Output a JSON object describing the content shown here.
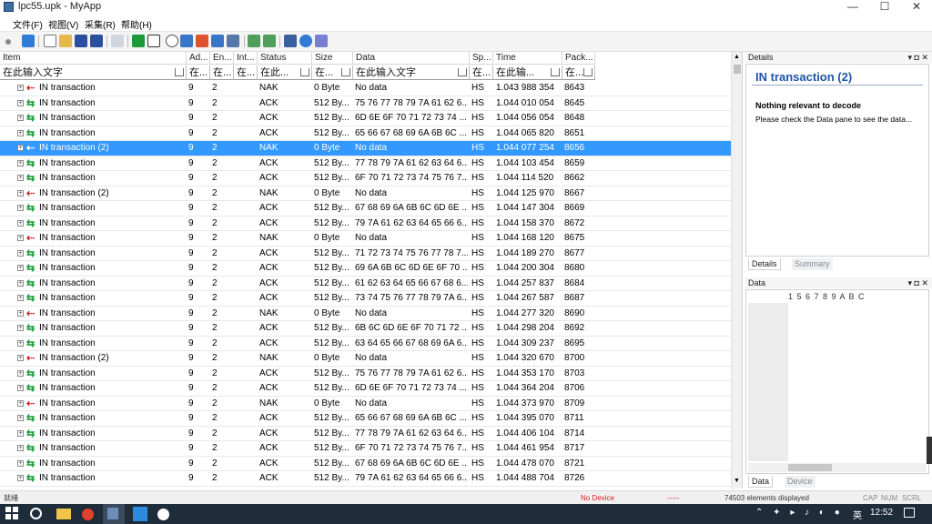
{
  "window": {
    "title": "lpc55.upk - MyApp",
    "minimize": "—",
    "maximize": "☐",
    "close": "✕"
  },
  "menu": [
    "文件(F)",
    "视图(V)",
    "采集(R)",
    "帮助(H)"
  ],
  "columns": [
    "Item",
    "Ad...",
    "En...",
    "Int...",
    "Status",
    "Size",
    "Data",
    "Sp...",
    "Time",
    "Pack..."
  ],
  "filters": [
    "在此输入文字",
    "在...",
    "在...",
    "在...",
    "在此...",
    "在...",
    "在此输入文字",
    "在...",
    "在此输...",
    "在..."
  ],
  "rows": [
    {
      "arrow": "red",
      "item": "IN transaction",
      "ad": "9",
      "en": "2",
      "status": "NAK",
      "size": "0 Byte",
      "data": "No data",
      "sp": "HS",
      "time": "1.043 988 354",
      "pack": "8643",
      "sel": false
    },
    {
      "arrow": "green",
      "item": "IN transaction",
      "ad": "9",
      "en": "2",
      "status": "ACK",
      "size": "512 By...",
      "data": "75 76 77 78 79 7A 61 62 6...",
      "sp": "HS",
      "time": "1.044 010 054",
      "pack": "8645",
      "sel": false
    },
    {
      "arrow": "green",
      "item": "IN transaction",
      "ad": "9",
      "en": "2",
      "status": "ACK",
      "size": "512 By...",
      "data": "6D 6E 6F 70 71 72 73 74 ...",
      "sp": "HS",
      "time": "1.044 056 054",
      "pack": "8648",
      "sel": false
    },
    {
      "arrow": "green",
      "item": "IN transaction",
      "ad": "9",
      "en": "2",
      "status": "ACK",
      "size": "512 By...",
      "data": "65 66 67 68 69 6A 6B 6C ...",
      "sp": "HS",
      "time": "1.044 065 820",
      "pack": "8651",
      "sel": false
    },
    {
      "arrow": "red",
      "item": "IN transaction (2)",
      "ad": "9",
      "en": "2",
      "status": "NAK",
      "size": "0 Byte",
      "data": "No data",
      "sp": "HS",
      "time": "1.044 077 254",
      "pack": "8656",
      "sel": true
    },
    {
      "arrow": "green",
      "item": "IN transaction",
      "ad": "9",
      "en": "2",
      "status": "ACK",
      "size": "512 By...",
      "data": "77 78 79 7A 61 62 63 64 6...",
      "sp": "HS",
      "time": "1.044 103 454",
      "pack": "8659",
      "sel": false
    },
    {
      "arrow": "green",
      "item": "IN transaction",
      "ad": "9",
      "en": "2",
      "status": "ACK",
      "size": "512 By...",
      "data": "6F 70 71 72 73 74 75 76 7...",
      "sp": "HS",
      "time": "1.044 114 520",
      "pack": "8662",
      "sel": false
    },
    {
      "arrow": "red",
      "item": "IN transaction (2)",
      "ad": "9",
      "en": "2",
      "status": "NAK",
      "size": "0 Byte",
      "data": "No data",
      "sp": "HS",
      "time": "1.044 125 970",
      "pack": "8667",
      "sel": false
    },
    {
      "arrow": "green",
      "item": "IN transaction",
      "ad": "9",
      "en": "2",
      "status": "ACK",
      "size": "512 By...",
      "data": "67 68 69 6A 6B 6C 6D 6E ...",
      "sp": "HS",
      "time": "1.044 147 304",
      "pack": "8669",
      "sel": false
    },
    {
      "arrow": "green",
      "item": "IN transaction",
      "ad": "9",
      "en": "2",
      "status": "ACK",
      "size": "512 By...",
      "data": "79 7A 61 62 63 64 65 66 6...",
      "sp": "HS",
      "time": "1.044 158 370",
      "pack": "8672",
      "sel": false
    },
    {
      "arrow": "red",
      "item": "IN transaction",
      "ad": "9",
      "en": "2",
      "status": "NAK",
      "size": "0 Byte",
      "data": "No data",
      "sp": "HS",
      "time": "1.044 168 120",
      "pack": "8675",
      "sel": false
    },
    {
      "arrow": "green",
      "item": "IN transaction",
      "ad": "9",
      "en": "2",
      "status": "ACK",
      "size": "512 By...",
      "data": "71 72 73 74 75 76 77 78 7...",
      "sp": "HS",
      "time": "1.044 189 270",
      "pack": "8677",
      "sel": false
    },
    {
      "arrow": "green",
      "item": "IN transaction",
      "ad": "9",
      "en": "2",
      "status": "ACK",
      "size": "512 By...",
      "data": "69 6A 6B 6C 6D 6E 6F 70 ...",
      "sp": "HS",
      "time": "1.044 200 304",
      "pack": "8680",
      "sel": false
    },
    {
      "arrow": "green",
      "item": "IN transaction",
      "ad": "9",
      "en": "2",
      "status": "ACK",
      "size": "512 By...",
      "data": "61 62 63 64 65 66 67 68 6...",
      "sp": "HS",
      "time": "1.044 257 837",
      "pack": "8684",
      "sel": false
    },
    {
      "arrow": "green",
      "item": "IN transaction",
      "ad": "9",
      "en": "2",
      "status": "ACK",
      "size": "512 By...",
      "data": "73 74 75 76 77 78 79 7A 6...",
      "sp": "HS",
      "time": "1.044 267 587",
      "pack": "8687",
      "sel": false
    },
    {
      "arrow": "red",
      "item": "IN transaction",
      "ad": "9",
      "en": "2",
      "status": "NAK",
      "size": "0 Byte",
      "data": "No data",
      "sp": "HS",
      "time": "1.044 277 320",
      "pack": "8690",
      "sel": false
    },
    {
      "arrow": "green",
      "item": "IN transaction",
      "ad": "9",
      "en": "2",
      "status": "ACK",
      "size": "512 By...",
      "data": "6B 6C 6D 6E 6F 70 71 72 ...",
      "sp": "HS",
      "time": "1.044 298 204",
      "pack": "8692",
      "sel": false
    },
    {
      "arrow": "green",
      "item": "IN transaction",
      "ad": "9",
      "en": "2",
      "status": "ACK",
      "size": "512 By...",
      "data": "63 64 65 66 67 68 69 6A 6...",
      "sp": "HS",
      "time": "1.044 309 237",
      "pack": "8695",
      "sel": false
    },
    {
      "arrow": "red",
      "item": "IN transaction (2)",
      "ad": "9",
      "en": "2",
      "status": "NAK",
      "size": "0 Byte",
      "data": "No data",
      "sp": "HS",
      "time": "1.044 320 670",
      "pack": "8700",
      "sel": false
    },
    {
      "arrow": "green",
      "item": "IN transaction",
      "ad": "9",
      "en": "2",
      "status": "ACK",
      "size": "512 By...",
      "data": "75 76 77 78 79 7A 61 62 6...",
      "sp": "HS",
      "time": "1.044 353 170",
      "pack": "8703",
      "sel": false
    },
    {
      "arrow": "green",
      "item": "IN transaction",
      "ad": "9",
      "en": "2",
      "status": "ACK",
      "size": "512 By...",
      "data": "6D 6E 6F 70 71 72 73 74 ...",
      "sp": "HS",
      "time": "1.044 364 204",
      "pack": "8706",
      "sel": false
    },
    {
      "arrow": "red",
      "item": "IN transaction",
      "ad": "9",
      "en": "2",
      "status": "NAK",
      "size": "0 Byte",
      "data": "No data",
      "sp": "HS",
      "time": "1.044 373 970",
      "pack": "8709",
      "sel": false
    },
    {
      "arrow": "green",
      "item": "IN transaction",
      "ad": "9",
      "en": "2",
      "status": "ACK",
      "size": "512 By...",
      "data": "65 66 67 68 69 6A 6B 6C ...",
      "sp": "HS",
      "time": "1.044 395 070",
      "pack": "8711",
      "sel": false
    },
    {
      "arrow": "green",
      "item": "IN transaction",
      "ad": "9",
      "en": "2",
      "status": "ACK",
      "size": "512 By...",
      "data": "77 78 79 7A 61 62 63 64 6...",
      "sp": "HS",
      "time": "1.044 406 104",
      "pack": "8714",
      "sel": false
    },
    {
      "arrow": "green",
      "item": "IN transaction",
      "ad": "9",
      "en": "2",
      "status": "ACK",
      "size": "512 By...",
      "data": "6F 70 71 72 73 74 75 76 7...",
      "sp": "HS",
      "time": "1.044 461 954",
      "pack": "8717",
      "sel": false
    },
    {
      "arrow": "green",
      "item": "IN transaction",
      "ad": "9",
      "en": "2",
      "status": "ACK",
      "size": "512 By...",
      "data": "67 68 69 6A 6B 6C 6D 6E ...",
      "sp": "HS",
      "time": "1.044 478 070",
      "pack": "8721",
      "sel": false
    },
    {
      "arrow": "green",
      "item": "IN transaction",
      "ad": "9",
      "en": "2",
      "status": "ACK",
      "size": "512 By...",
      "data": "79 7A 61 62 63 64 65 66 6...",
      "sp": "HS",
      "time": "1.044 488 704",
      "pack": "8726",
      "sel": false
    }
  ],
  "details": {
    "header": "Details",
    "title": "IN transaction (2)",
    "subtitle": "Nothing relevant to decode",
    "text": "Please check the Data pane to see the data...",
    "tab_details": "Details",
    "tab_summary": "Summary"
  },
  "data_pane": {
    "header": "Data",
    "ruler": "1 5 6 7 8 9 A B C",
    "tab_data": "Data",
    "tab_device": "Device"
  },
  "status": {
    "left": "就绪",
    "device": "No Device",
    "dash": "-----",
    "count": "74503 elements displayed",
    "caps": "CAP",
    "num": "NUM",
    "scrl": "SCRL"
  },
  "taskbar": {
    "time": "12:52",
    "ime": "英"
  },
  "colors": {
    "selection": "#3399ff",
    "green_arrow": "#1a9a3a",
    "red_arrow": "#d21f1f",
    "title_blue": "#1f55a8",
    "nodevice": "#d32020"
  }
}
